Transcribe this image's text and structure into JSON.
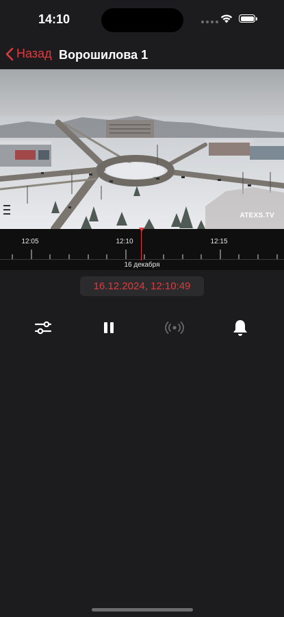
{
  "status": {
    "time": "14:10"
  },
  "nav": {
    "back_label": "Назад",
    "title": "Ворошилова 1"
  },
  "video": {
    "watermark": "ATEXS.TV"
  },
  "timeline": {
    "labels": [
      "12:05",
      "12:10",
      "12:15"
    ],
    "date": "16 декабря"
  },
  "datetime": "16.12.2024, 12:10:49",
  "colors": {
    "accent": "#e03a3e",
    "background": "#1c1c1e"
  },
  "controls": [
    "sliders-icon",
    "pause-icon",
    "broadcast-icon",
    "bell-icon"
  ]
}
